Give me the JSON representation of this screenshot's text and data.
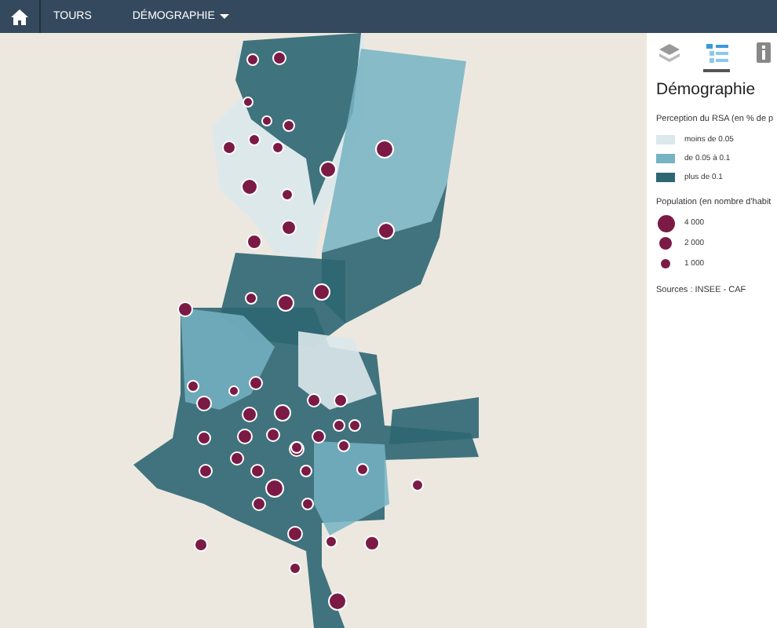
{
  "navbar": {
    "items": [
      {
        "kind": "home",
        "selected": false
      },
      {
        "kind": "link",
        "label": "TOURS",
        "selected": false
      },
      {
        "kind": "dropdown",
        "label": "DÉMOGRAPHIE",
        "selected": false
      }
    ]
  },
  "sidebar": {
    "tabs": [
      {
        "kind": "layers",
        "selected": false
      },
      {
        "kind": "legend",
        "selected": true
      },
      {
        "kind": "info",
        "selected": false
      }
    ],
    "title": "Démographie",
    "classes_title": "Perception du RSA (en % de p",
    "classes": [
      {
        "label": "moins de 0.05",
        "color": "#dbe8ec"
      },
      {
        "label": "de 0.05 à 0.1",
        "color": "#76b3c3"
      },
      {
        "label": "plus de 0.1",
        "color": "#2e6672"
      }
    ],
    "sizes_title": "Population (en nombre d'habit",
    "sizes": [
      {
        "label": "4 000",
        "kind": "large"
      },
      {
        "label": "2 000",
        "kind": "medium"
      },
      {
        "label": "1 000",
        "kind": "small"
      }
    ],
    "sources": "Sources : INSEE - CAF"
  }
}
